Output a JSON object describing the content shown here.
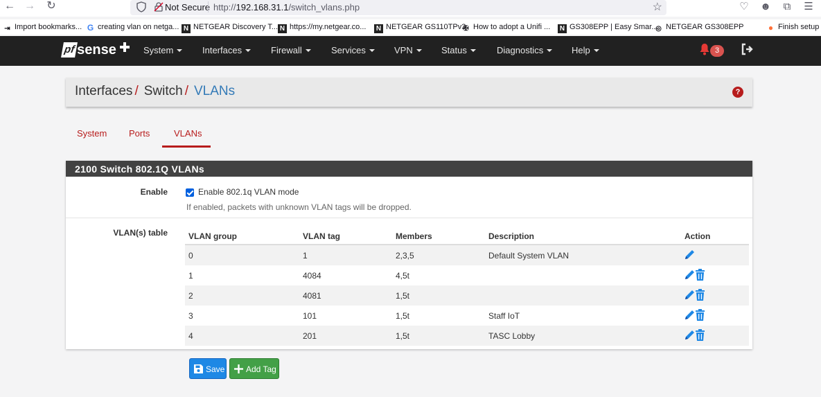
{
  "browser": {
    "security_label": "Not Secure",
    "url_prefix": "http://",
    "url_host": "192.168.31.1",
    "url_path": "/switch_vlans.php"
  },
  "bookmarks": [
    {
      "label": "Import bookmarks...",
      "icon": "import-icon"
    },
    {
      "label": "creating vlan on netga...",
      "icon": "google-icon"
    },
    {
      "label": "NETGEAR Discovery T...",
      "icon": "netgear-icon"
    },
    {
      "label": "https://my.netgear.co...",
      "icon": "netgear-icon"
    },
    {
      "label": "NETGEAR GS110TPv3",
      "icon": "netgear-icon"
    },
    {
      "label": "How to adopt a Unifi ...",
      "icon": "ubiquiti-icon"
    },
    {
      "label": "GS308EPP | Easy Smar...",
      "icon": "netgear-icon"
    },
    {
      "label": "NETGEAR GS308EPP",
      "icon": "globe-icon"
    },
    {
      "label": "Finish setup",
      "icon": "firefox-icon"
    }
  ],
  "navbar": {
    "logo_pf": "pf",
    "logo_sense": "sense",
    "menu": [
      "System",
      "Interfaces",
      "Firewall",
      "Services",
      "VPN",
      "Status",
      "Diagnostics",
      "Help"
    ],
    "notification_count": "3"
  },
  "breadcrumb": {
    "parts": [
      "Interfaces",
      "Switch"
    ],
    "active": "VLANs",
    "help": "?"
  },
  "tabs": [
    "System",
    "Ports",
    "VLANs"
  ],
  "active_tab": "VLANs",
  "panel": {
    "title": "2100 Switch 802.1Q VLANs",
    "enable_label": "Enable",
    "enable_checkbox_label": "Enable 802.1q VLAN mode",
    "enable_checked": true,
    "enable_hint": "If enabled, packets with unknown VLAN tags will be dropped.",
    "table_label": "VLAN(s) table",
    "columns": [
      "VLAN group",
      "VLAN tag",
      "Members",
      "Description",
      "Action"
    ],
    "rows": [
      {
        "group": "0",
        "tag": "1",
        "members": "2,3,5",
        "description": "Default System VLAN",
        "deletable": false
      },
      {
        "group": "1",
        "tag": "4084",
        "members": "4,5t",
        "description": "",
        "deletable": true
      },
      {
        "group": "2",
        "tag": "4081",
        "members": "1,5t",
        "description": "",
        "deletable": true
      },
      {
        "group": "3",
        "tag": "101",
        "members": "1,5t",
        "description": "Staff IoT",
        "deletable": true
      },
      {
        "group": "4",
        "tag": "201",
        "members": "1,5t",
        "description": "TASC Lobby",
        "deletable": true
      }
    ]
  },
  "buttons": {
    "save": "Save",
    "add_tag": "Add Tag"
  },
  "colors": {
    "brand_red": "#b71c1c",
    "link_blue": "#337ab7",
    "save_blue": "#1e88e5",
    "add_green": "#43a047",
    "navbar_bg": "#212121"
  }
}
